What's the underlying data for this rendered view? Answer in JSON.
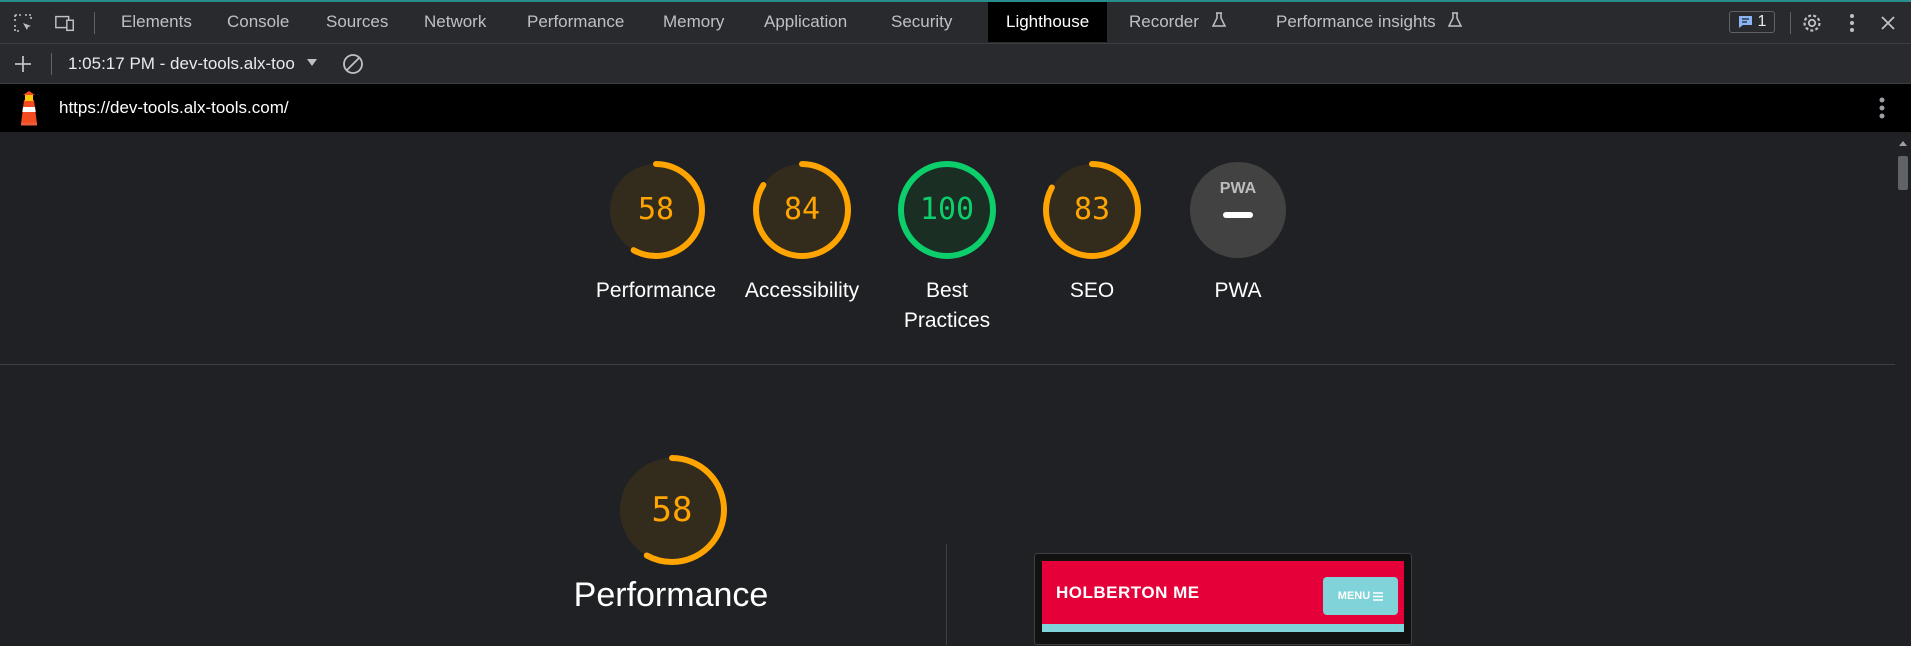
{
  "devtools": {
    "tabs": [
      {
        "label": "Elements"
      },
      {
        "label": "Console"
      },
      {
        "label": "Sources"
      },
      {
        "label": "Network"
      },
      {
        "label": "Performance"
      },
      {
        "label": "Memory"
      },
      {
        "label": "Application"
      },
      {
        "label": "Security"
      },
      {
        "label": "Lighthouse",
        "active": true
      },
      {
        "label": "Recorder",
        "experimental": true
      },
      {
        "label": "Performance insights",
        "experimental": true
      }
    ],
    "issues_count": "1"
  },
  "toolbar": {
    "report_selector": "1:05:17 PM - dev-tools.alx-too"
  },
  "report": {
    "url": "https://dev-tools.alx-tools.com/",
    "gauges": [
      {
        "label": "Performance",
        "score": "58",
        "score_value": 58,
        "color": "#ffa400"
      },
      {
        "label": "Accessibility",
        "score": "84",
        "score_value": 84,
        "color": "#ffa400"
      },
      {
        "label": "Best Practices",
        "score": "100",
        "score_value": 100,
        "color": "#0cce6b"
      },
      {
        "label": "SEO",
        "score": "83",
        "score_value": 83,
        "color": "#ffa400"
      },
      {
        "label": "PWA",
        "badge": "PWA"
      }
    ],
    "performance": {
      "score": "58",
      "score_value": 58,
      "title": "Performance"
    },
    "screenshot": {
      "brand": "HOLBERTON ME",
      "menu_label": "MENU"
    }
  },
  "colors": {
    "average": "#ffa400",
    "pass": "#0cce6b",
    "brand_red": "#e6003a",
    "brand_teal": "#7fd3d9"
  }
}
